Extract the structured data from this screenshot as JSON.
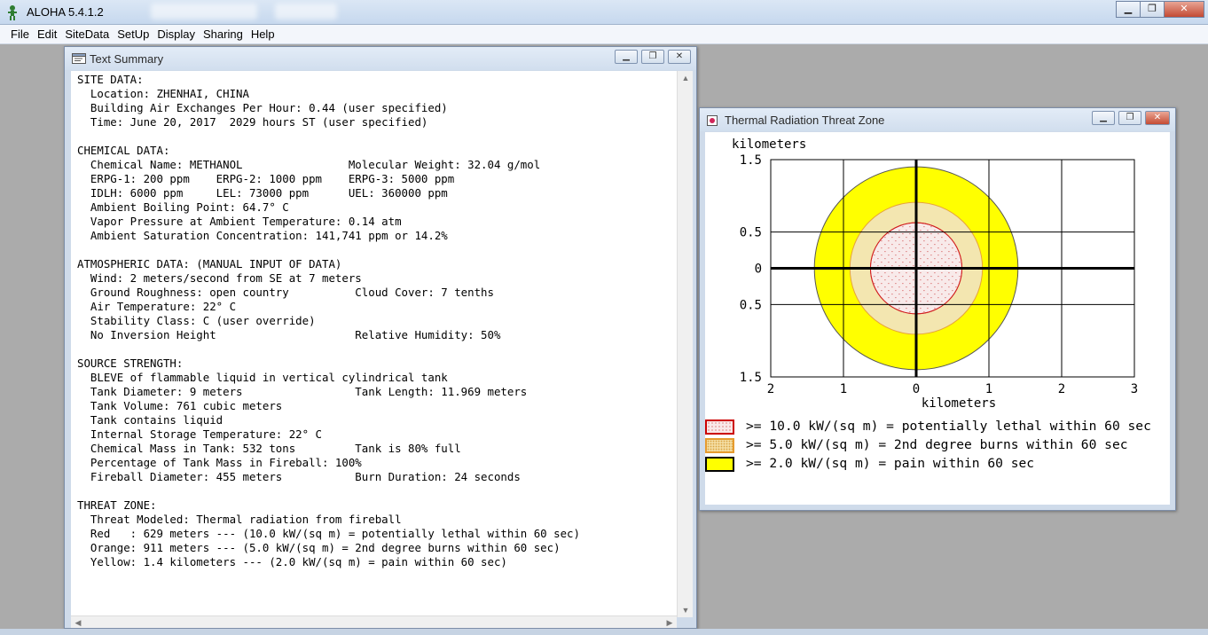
{
  "app": {
    "title": "ALOHA 5.4.1.2",
    "menu": [
      "File",
      "Edit",
      "SiteData",
      "SetUp",
      "Display",
      "Sharing",
      "Help"
    ]
  },
  "text_summary": {
    "title": "Text Summary",
    "lines": [
      "SITE DATA:",
      "  Location: ZHENHAI, CHINA",
      "  Building Air Exchanges Per Hour: 0.44 (user specified)",
      "  Time: June 20, 2017  2029 hours ST (user specified)",
      "",
      "CHEMICAL DATA:",
      "  Chemical Name: METHANOL                Molecular Weight: 32.04 g/mol",
      "  ERPG-1: 200 ppm    ERPG-2: 1000 ppm    ERPG-3: 5000 ppm",
      "  IDLH: 6000 ppm     LEL: 73000 ppm      UEL: 360000 ppm",
      "  Ambient Boiling Point: 64.7° C",
      "  Vapor Pressure at Ambient Temperature: 0.14 atm",
      "  Ambient Saturation Concentration: 141,741 ppm or 14.2%",
      "",
      "ATMOSPHERIC DATA: (MANUAL INPUT OF DATA)",
      "  Wind: 2 meters/second from SE at 7 meters",
      "  Ground Roughness: open country          Cloud Cover: 7 tenths",
      "  Air Temperature: 22° C",
      "  Stability Class: C (user override)",
      "  No Inversion Height                     Relative Humidity: 50%",
      "",
      "SOURCE STRENGTH:",
      "  BLEVE of flammable liquid in vertical cylindrical tank",
      "  Tank Diameter: 9 meters                 Tank Length: 11.969 meters",
      "  Tank Volume: 761 cubic meters",
      "  Tank contains liquid",
      "  Internal Storage Temperature: 22° C",
      "  Chemical Mass in Tank: 532 tons         Tank is 80% full",
      "  Percentage of Tank Mass in Fireball: 100%",
      "  Fireball Diameter: 455 meters           Burn Duration: 24 seconds",
      "",
      "THREAT ZONE:",
      "  Threat Modeled: Thermal radiation from fireball",
      "  Red   : 629 meters --- (10.0 kW/(sq m) = potentially lethal within 60 sec)",
      "  Orange: 911 meters --- (5.0 kW/(sq m) = 2nd degree burns within 60 sec)",
      "  Yellow: 1.4 kilometers --- (2.0 kW/(sq m) = pain within 60 sec)"
    ]
  },
  "threat_zone": {
    "title": "Thermal Radiation Threat Zone",
    "y_axis_label": "kilometers",
    "x_axis_label": "kilometers",
    "y_ticks": [
      {
        "value": 1.5,
        "label": "1.5"
      },
      {
        "value": 0.5,
        "label": "0.5"
      },
      {
        "value": 0,
        "label": "0"
      },
      {
        "value": -0.5,
        "label": "0.5"
      },
      {
        "value": -1.5,
        "label": "1.5"
      }
    ],
    "x_ticks": [
      {
        "value": -2,
        "label": "2"
      },
      {
        "value": -1,
        "label": "1"
      },
      {
        "value": 0,
        "label": "0"
      },
      {
        "value": 1,
        "label": "1"
      },
      {
        "value": 2,
        "label": "2"
      },
      {
        "value": 3,
        "label": "3"
      }
    ],
    "xlim": [
      -2,
      3
    ],
    "ylim": [
      -1.5,
      1.5
    ],
    "zones": [
      {
        "name": "yellow",
        "radius_km": 1.4,
        "fill": "#ffff00",
        "stroke": "#555555"
      },
      {
        "name": "orange",
        "radius_km": 0.911,
        "fill": "#f3e6b0",
        "stroke": "#e6a23c"
      },
      {
        "name": "red",
        "radius_km": 0.629,
        "fill": "#f8eaea",
        "stroke": "#d12020"
      }
    ],
    "legend": [
      {
        "text": ">= 10.0 kW/(sq m) = potentially lethal within 60 sec",
        "swatch_fill": "#f8e8e8",
        "swatch_border": "#cc0000"
      },
      {
        "text": ">= 5.0 kW/(sq m) = 2nd degree burns within 60 sec",
        "swatch_fill": "#f3dca0",
        "swatch_border": "#e69b2e"
      },
      {
        "text": ">= 2.0 kW/(sq m) = pain within 60 sec",
        "swatch_fill": "#ffff00",
        "swatch_border": "#000000"
      }
    ]
  },
  "chart_data": {
    "type": "scatter",
    "title": "Thermal Radiation Threat Zone",
    "xlabel": "kilometers",
    "ylabel": "kilometers",
    "xlim": [
      -2,
      3
    ],
    "ylim": [
      -1.5,
      1.5
    ],
    "grid": true,
    "series": [
      {
        "name": ">= 10.0 kW/(sq m) = potentially lethal within 60 sec",
        "radius_km": 0.629
      },
      {
        "name": ">= 5.0 kW/(sq m) = 2nd degree burns within 60 sec",
        "radius_km": 0.911
      },
      {
        "name": ">= 2.0 kW/(sq m) = pain within 60 sec",
        "radius_km": 1.4
      }
    ]
  }
}
